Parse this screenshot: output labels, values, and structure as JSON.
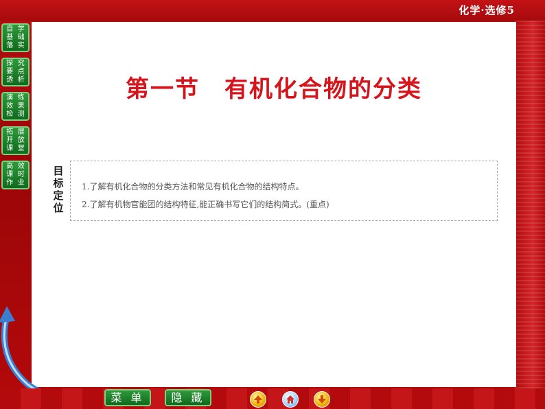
{
  "header": {
    "course": "化学·选修5"
  },
  "nav": [
    {
      "id": "jichu",
      "chars": [
        "自",
        "学",
        "基",
        "础",
        "落",
        "实"
      ]
    },
    {
      "id": "tanjiu",
      "chars": [
        "探",
        "究",
        "要",
        "点",
        "透",
        "析"
      ]
    },
    {
      "id": "jiance",
      "chars": [
        "演",
        "练",
        "效",
        "果",
        "检",
        "测"
      ]
    },
    {
      "id": "tuozhan",
      "chars": [
        "拓",
        "展",
        "开",
        "放",
        "课",
        "堂"
      ]
    },
    {
      "id": "zuoye",
      "chars": [
        "高",
        "效",
        "课",
        "时",
        "作",
        "业"
      ]
    }
  ],
  "main": {
    "title": "第一节　有机化合物的分类",
    "objective_label": "目标定位",
    "objectives": [
      "1.了解有机化合物的分类方法和常见有机化合物的结构特点。",
      "2.了解有机物官能团的结构特征,能正确书写它们的结构简式。(重点)"
    ]
  },
  "footer": {
    "menu_label": "菜 单",
    "hide_label": "隐 藏"
  },
  "colors": {
    "accent_red": "#d6141c",
    "nav_green": "#1f8a2e",
    "bg_red": "#a80a0c"
  }
}
